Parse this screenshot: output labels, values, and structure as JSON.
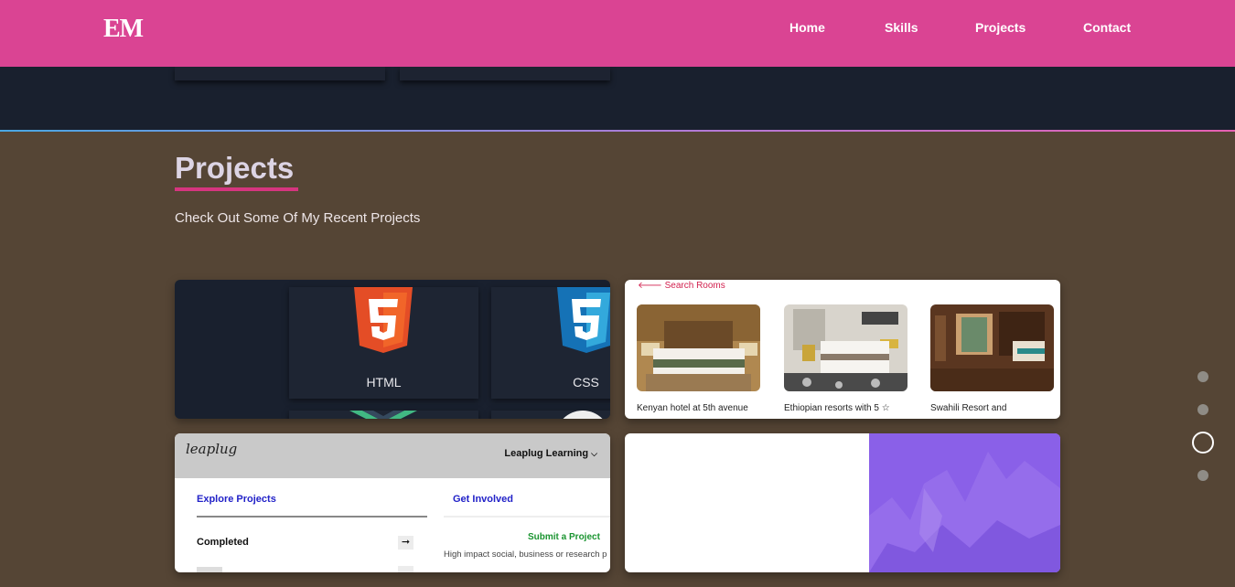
{
  "navbar": {
    "logo": "EM",
    "links": [
      "Home",
      "Skills",
      "Projects",
      "Contact"
    ],
    "background": "#da4493"
  },
  "projects": {
    "title": "Projects",
    "subtitle": "Check Out Some Of My Recent Projects",
    "accent": "#d6357f"
  },
  "cards": {
    "skills": {
      "tiles": [
        {
          "label": "HTML",
          "icon": "html5-icon"
        },
        {
          "label": "CSS",
          "icon": "css3-icon"
        }
      ]
    },
    "rooms": {
      "search_link": "Search Rooms",
      "rooms": [
        {
          "caption": "Kenyan hotel at 5th avenue"
        },
        {
          "caption": "Ethiopian resorts with 5 ☆"
        },
        {
          "caption": "Swahili Resort and"
        }
      ]
    },
    "leaplug": {
      "logo": "leaplug",
      "brand": "Leaplug Learning",
      "tab_explore": "Explore Projects",
      "tab_involved": "Get Involved",
      "row_completed": "Completed",
      "submit_link": "Submit a Project",
      "submit_desc": "High impact social, business or research p"
    }
  },
  "section_nav": {
    "count": 4,
    "active_index": 2
  }
}
